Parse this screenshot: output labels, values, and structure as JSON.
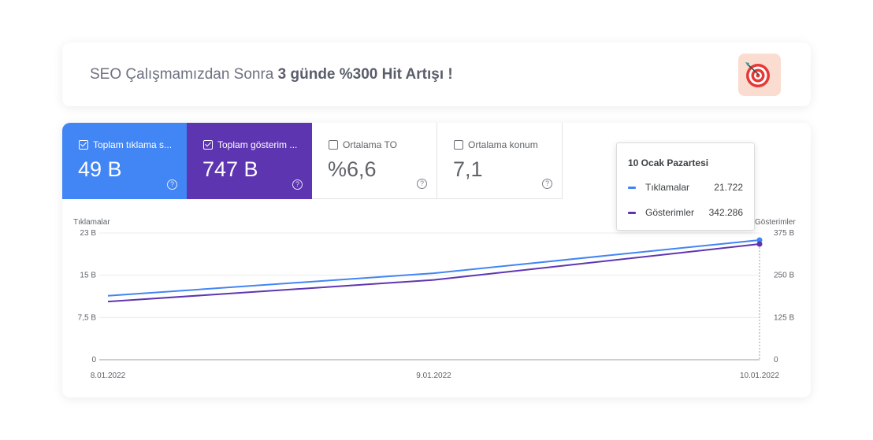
{
  "banner": {
    "text_prefix": "SEO Çalışmamızdan Sonra ",
    "text_bold": "3 günde %300 Hit Artışı !",
    "icon": "target-icon"
  },
  "metrics": [
    {
      "label": "Toplam tıklama s...",
      "value": "49 B",
      "checked": true,
      "color": "#4285f4"
    },
    {
      "label": "Toplam gösterim ...",
      "value": "747 B",
      "checked": true,
      "color": "#5e35b1"
    },
    {
      "label": "Ortalama TO",
      "value": "%6,6",
      "checked": false
    },
    {
      "label": "Ortalama konum",
      "value": "7,1",
      "checked": false
    }
  ],
  "tooltip": {
    "title": "10 Ocak Pazartesi",
    "rows": [
      {
        "label": "Tıklamalar",
        "value": "21.722"
      },
      {
        "label": "Gösterimler",
        "value": "342.286"
      }
    ]
  },
  "chart_data": {
    "type": "line",
    "x": [
      "8.01.2022",
      "9.01.2022",
      "10.01.2022"
    ],
    "series": [
      {
        "name": "Tıklamalar",
        "axis": "left",
        "color": "#4285f4",
        "values": [
          11600,
          15700,
          21722
        ]
      },
      {
        "name": "Gösterimler",
        "axis": "right",
        "color": "#5e35b1",
        "values": [
          172000,
          236000,
          342286
        ]
      }
    ],
    "ylabel_left": "Tıklamalar",
    "ylabel_right": "Gösterimler",
    "ylim_left": [
      0,
      23000
    ],
    "ylim_right": [
      0,
      375000
    ],
    "yticks_left": [
      "0",
      "7,5 B",
      "15 B",
      "23 B"
    ],
    "yticks_right": [
      "0",
      "125 B",
      "250 B",
      "375 B"
    ],
    "grid": true
  }
}
